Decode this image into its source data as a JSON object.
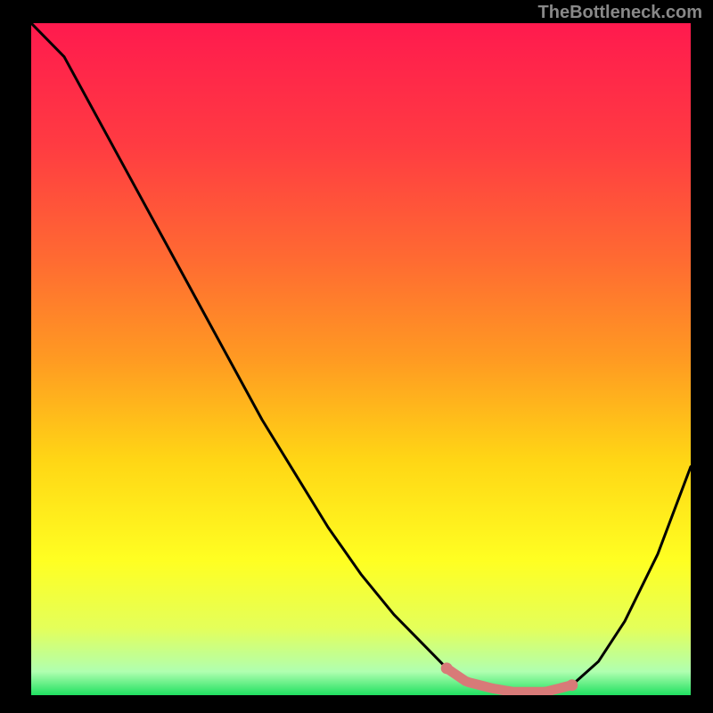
{
  "watermark": "TheBottleneck.com",
  "chart_data": {
    "type": "line",
    "title": "",
    "xlabel": "",
    "ylabel": "",
    "xlim": [
      0,
      100
    ],
    "ylim": [
      0,
      100
    ],
    "x": [
      0,
      5,
      10,
      15,
      20,
      25,
      30,
      35,
      40,
      45,
      50,
      55,
      60,
      63,
      66,
      70,
      73,
      78,
      82,
      86,
      90,
      95,
      100
    ],
    "values": [
      100,
      95,
      86,
      77,
      68,
      59,
      50,
      41,
      33,
      25,
      18,
      12,
      7,
      4,
      2,
      1,
      0.5,
      0.5,
      1.5,
      5,
      11,
      21,
      34
    ],
    "highlight_segment": {
      "x_start": 63,
      "x_end": 82,
      "color": "#d87a78"
    },
    "gradient_stops": [
      {
        "pos": 0.0,
        "color": "#ff1a4e"
      },
      {
        "pos": 0.18,
        "color": "#ff3b42"
      },
      {
        "pos": 0.35,
        "color": "#ff6a32"
      },
      {
        "pos": 0.5,
        "color": "#ff9a22"
      },
      {
        "pos": 0.65,
        "color": "#ffd615"
      },
      {
        "pos": 0.8,
        "color": "#ffff22"
      },
      {
        "pos": 0.9,
        "color": "#e4ff5a"
      },
      {
        "pos": 0.965,
        "color": "#b0ffb0"
      },
      {
        "pos": 1.0,
        "color": "#20e060"
      }
    ]
  }
}
